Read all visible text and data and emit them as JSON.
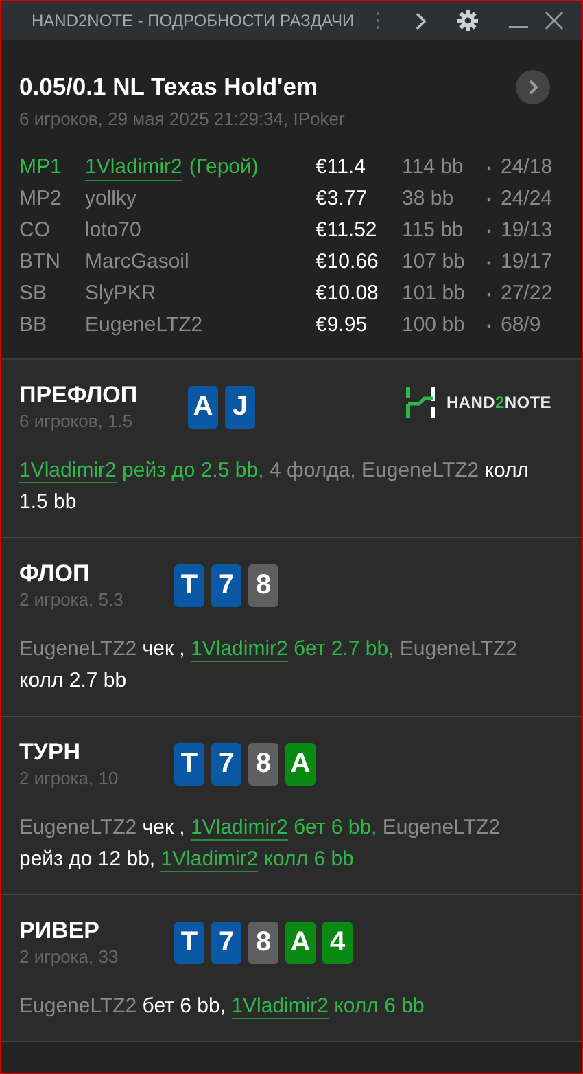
{
  "window": {
    "title": "HAND2NOTE - ПОДРОБНОСТИ РАЗДАЧИ"
  },
  "hand": {
    "title": "0.05/0.1 NL Texas Hold'em",
    "subtitle": "6 игроков, 29 мая 2025 21:29:34, IPoker"
  },
  "players": [
    {
      "position": "MP1",
      "name": "1Vladimir2",
      "hero_label": "(Герой)",
      "hero": true,
      "stack": "€11.4",
      "bb": "114 bb",
      "stats": "24/18"
    },
    {
      "position": "MP2",
      "name": "yollky",
      "hero": false,
      "stack": "€3.77",
      "bb": "38 bb",
      "stats": "24/24"
    },
    {
      "position": "CO",
      "name": "loto70",
      "hero": false,
      "stack": "€11.52",
      "bb": "115 bb",
      "stats": "19/13"
    },
    {
      "position": "BTN",
      "name": "MarcGasoil",
      "hero": false,
      "stack": "€10.66",
      "bb": "107 bb",
      "stats": "19/17"
    },
    {
      "position": "SB",
      "name": "SlyPKR",
      "hero": false,
      "stack": "€10.08",
      "bb": "101 bb",
      "stats": "27/22"
    },
    {
      "position": "BB",
      "name": "EugeneLTZ2",
      "hero": false,
      "stack": "€9.95",
      "bb": "100 bb",
      "stats": "68/9"
    }
  ],
  "streets": [
    {
      "name": "ПРЕФЛОП",
      "info": "6 игроков, 1.5",
      "logo": [
        "HAND",
        "2",
        "NOTE"
      ],
      "cards": [
        {
          "rank": "A",
          "color": "#0b58a5"
        },
        {
          "rank": "J",
          "color": "#0b58a5"
        }
      ],
      "actions": [
        {
          "kind": "hero-name",
          "text": "1Vladimir2"
        },
        {
          "kind": "hero-action",
          "text": " рейз до 2.5 bb,"
        },
        {
          "kind": "other",
          "text": " 4 фолда, EugeneLTZ2"
        },
        {
          "kind": "villain-action",
          "text": " колл 1.5 bb"
        }
      ]
    },
    {
      "name": "ФЛОП",
      "info": "2 игрока, 5.3",
      "cards": [
        {
          "rank": "T",
          "color": "#0b58a5"
        },
        {
          "rank": "7",
          "color": "#0b58a5"
        },
        {
          "rank": "8",
          "color": "#5f5f5f"
        }
      ],
      "actions": [
        {
          "kind": "other",
          "text": "EugeneLTZ2"
        },
        {
          "kind": "villain-action",
          "text": " чек , "
        },
        {
          "kind": "hero-name",
          "text": "1Vladimir2"
        },
        {
          "kind": "hero-action",
          "text": " бет 2.7 bb,"
        },
        {
          "kind": "other",
          "text": " EugeneLTZ2"
        },
        {
          "kind": "villain-action",
          "text": " колл 2.7 bb"
        }
      ]
    },
    {
      "name": "ТУРН",
      "info": "2 игрока, 10",
      "cards": [
        {
          "rank": "T",
          "color": "#0b58a5"
        },
        {
          "rank": "7",
          "color": "#0b58a5"
        },
        {
          "rank": "8",
          "color": "#5f5f5f"
        },
        {
          "rank": "A",
          "color": "#0a8a12"
        }
      ],
      "actions": [
        {
          "kind": "other",
          "text": "EugeneLTZ2"
        },
        {
          "kind": "villain-action",
          "text": " чек , "
        },
        {
          "kind": "hero-name",
          "text": "1Vladimir2"
        },
        {
          "kind": "hero-action",
          "text": " бет 6 bb,"
        },
        {
          "kind": "other",
          "text": " EugeneLTZ2"
        },
        {
          "kind": "villain-action",
          "text": " рейз до 12 bb, "
        },
        {
          "kind": "hero-name",
          "text": "1Vladimir2"
        },
        {
          "kind": "hero-action",
          "text": " колл 6 bb"
        }
      ]
    },
    {
      "name": "РИВЕР",
      "info": "2 игрока, 33",
      "cards": [
        {
          "rank": "T",
          "color": "#0b58a5"
        },
        {
          "rank": "7",
          "color": "#0b58a5"
        },
        {
          "rank": "8",
          "color": "#5f5f5f"
        },
        {
          "rank": "A",
          "color": "#0a8a12"
        },
        {
          "rank": "4",
          "color": "#0a8a12"
        }
      ],
      "actions": [
        {
          "kind": "other",
          "text": "EugeneLTZ2"
        },
        {
          "kind": "villain-action",
          "text": " бет 6 bb, "
        },
        {
          "kind": "hero-name",
          "text": "1Vladimir2"
        },
        {
          "kind": "hero-action",
          "text": " колл 6 bb"
        }
      ]
    }
  ]
}
